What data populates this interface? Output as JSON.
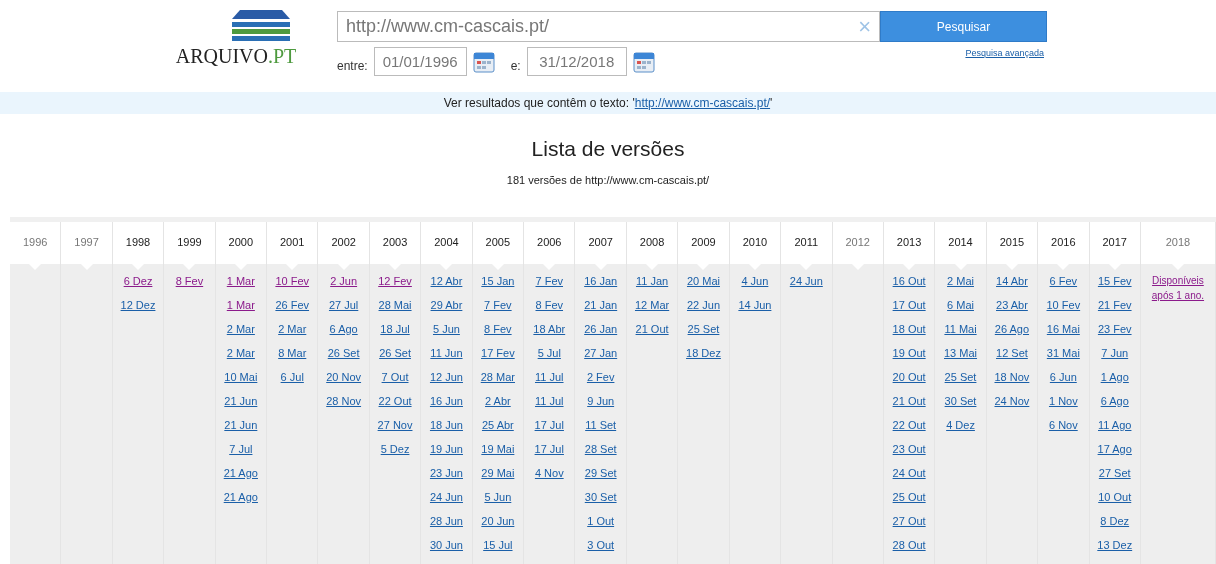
{
  "logo": {
    "text": "ARQUIVO",
    "suffix": ".PT"
  },
  "search": {
    "value": "http://www.cm-cascais.pt/",
    "clear": "×",
    "button": "Pesquisar",
    "advanced": "Pesquisa avançada"
  },
  "dates": {
    "from_label": "entre:",
    "from": "01/01/1996",
    "to_label": "e:",
    "to": "31/12/2018"
  },
  "banner": {
    "text": "Ver resultados que contêm o texto: '",
    "link": "http://www.cm-cascais.pt/",
    "after": "'"
  },
  "title": "Lista de versões",
  "subtitle": "181 versões de http://www.cm-cascais.pt/",
  "years": [
    {
      "year": "1996",
      "disabled": true
    },
    {
      "year": "1997",
      "disabled": true
    },
    {
      "year": "1998",
      "disabled": false,
      "versions": [
        {
          "label": "6 Dez",
          "visited": true
        },
        {
          "label": "12 Dez",
          "visited": false
        }
      ]
    },
    {
      "year": "1999",
      "disabled": false,
      "versions": [
        {
          "label": "8 Fev",
          "visited": true
        }
      ]
    },
    {
      "year": "2000",
      "disabled": false,
      "versions": [
        {
          "label": "1 Mar",
          "visited": true
        },
        {
          "label": "1 Mar",
          "visited": true
        },
        {
          "label": "2 Mar",
          "visited": false
        },
        {
          "label": "2 Mar",
          "visited": false
        },
        {
          "label": "10 Mai",
          "visited": false
        },
        {
          "label": "21 Jun",
          "visited": false
        },
        {
          "label": "21 Jun",
          "visited": false
        },
        {
          "label": "7 Jul",
          "visited": false
        },
        {
          "label": "21 Ago",
          "visited": false
        },
        {
          "label": "21 Ago",
          "visited": false
        }
      ]
    },
    {
      "year": "2001",
      "disabled": false,
      "versions": [
        {
          "label": "10 Fev",
          "visited": true
        },
        {
          "label": "26 Fev",
          "visited": false
        },
        {
          "label": "2 Mar",
          "visited": false
        },
        {
          "label": "8 Mar",
          "visited": false
        },
        {
          "label": "6 Jul",
          "visited": false
        }
      ]
    },
    {
      "year": "2002",
      "disabled": false,
      "versions": [
        {
          "label": "2 Jun",
          "visited": true
        },
        {
          "label": "27 Jul",
          "visited": false
        },
        {
          "label": "6 Ago",
          "visited": false
        },
        {
          "label": "26 Set",
          "visited": false
        },
        {
          "label": "20 Nov",
          "visited": false
        },
        {
          "label": "28 Nov",
          "visited": false
        }
      ]
    },
    {
      "year": "2003",
      "disabled": false,
      "versions": [
        {
          "label": "12 Fev",
          "visited": true
        },
        {
          "label": "28 Mai",
          "visited": false
        },
        {
          "label": "18 Jul",
          "visited": false
        },
        {
          "label": "26 Set",
          "visited": false
        },
        {
          "label": "7 Out",
          "visited": false
        },
        {
          "label": "22 Out",
          "visited": false
        },
        {
          "label": "27 Nov",
          "visited": false
        },
        {
          "label": "5 Dez",
          "visited": false
        }
      ]
    },
    {
      "year": "2004",
      "disabled": false,
      "versions": [
        {
          "label": "12 Abr",
          "visited": false
        },
        {
          "label": "29 Abr",
          "visited": false
        },
        {
          "label": "5 Jun",
          "visited": false
        },
        {
          "label": "11 Jun",
          "visited": false
        },
        {
          "label": "12 Jun",
          "visited": false
        },
        {
          "label": "16 Jun",
          "visited": false
        },
        {
          "label": "18 Jun",
          "visited": false
        },
        {
          "label": "19 Jun",
          "visited": false
        },
        {
          "label": "23 Jun",
          "visited": false
        },
        {
          "label": "24 Jun",
          "visited": false
        },
        {
          "label": "28 Jun",
          "visited": false
        },
        {
          "label": "30 Jun",
          "visited": false
        }
      ]
    },
    {
      "year": "2005",
      "disabled": false,
      "versions": [
        {
          "label": "15 Jan",
          "visited": false
        },
        {
          "label": "7 Fev",
          "visited": false
        },
        {
          "label": "8 Fev",
          "visited": false
        },
        {
          "label": "17 Fev",
          "visited": false
        },
        {
          "label": "28 Mar",
          "visited": false
        },
        {
          "label": "2 Abr",
          "visited": false
        },
        {
          "label": "25 Abr",
          "visited": false
        },
        {
          "label": "19 Mai",
          "visited": false
        },
        {
          "label": "29 Mai",
          "visited": false
        },
        {
          "label": "5 Jun",
          "visited": false
        },
        {
          "label": "20 Jun",
          "visited": false
        },
        {
          "label": "15 Jul",
          "visited": false
        }
      ]
    },
    {
      "year": "2006",
      "disabled": false,
      "versions": [
        {
          "label": "7 Fev",
          "visited": false
        },
        {
          "label": "8 Fev",
          "visited": false
        },
        {
          "label": "18 Abr",
          "visited": false
        },
        {
          "label": "5 Jul",
          "visited": false
        },
        {
          "label": "11 Jul",
          "visited": false
        },
        {
          "label": "11 Jul",
          "visited": false
        },
        {
          "label": "17 Jul",
          "visited": false
        },
        {
          "label": "17 Jul",
          "visited": false
        },
        {
          "label": "4 Nov",
          "visited": false
        }
      ]
    },
    {
      "year": "2007",
      "disabled": false,
      "versions": [
        {
          "label": "16 Jan",
          "visited": false
        },
        {
          "label": "21 Jan",
          "visited": false
        },
        {
          "label": "26 Jan",
          "visited": false
        },
        {
          "label": "27 Jan",
          "visited": false
        },
        {
          "label": "2 Fev",
          "visited": false
        },
        {
          "label": "9 Jun",
          "visited": false
        },
        {
          "label": "11 Set",
          "visited": false
        },
        {
          "label": "28 Set",
          "visited": false
        },
        {
          "label": "29 Set",
          "visited": false
        },
        {
          "label": "30 Set",
          "visited": false
        },
        {
          "label": "1 Out",
          "visited": false
        },
        {
          "label": "3 Out",
          "visited": false
        }
      ]
    },
    {
      "year": "2008",
      "disabled": false,
      "versions": [
        {
          "label": "11 Jan",
          "visited": false
        },
        {
          "label": "12 Mar",
          "visited": false
        },
        {
          "label": "21 Out",
          "visited": false
        }
      ]
    },
    {
      "year": "2009",
      "disabled": false,
      "versions": [
        {
          "label": "20 Mai",
          "visited": false
        },
        {
          "label": "22 Jun",
          "visited": false
        },
        {
          "label": "25 Set",
          "visited": false
        },
        {
          "label": "18 Dez",
          "visited": false
        }
      ]
    },
    {
      "year": "2010",
      "disabled": false,
      "versions": [
        {
          "label": "4 Jun",
          "visited": false
        },
        {
          "label": "14 Jun",
          "visited": false
        }
      ]
    },
    {
      "year": "2011",
      "disabled": false,
      "versions": [
        {
          "label": "24 Jun",
          "visited": false
        }
      ]
    },
    {
      "year": "2012",
      "disabled": true
    },
    {
      "year": "2013",
      "disabled": false,
      "versions": [
        {
          "label": "16 Out",
          "visited": false
        },
        {
          "label": "17 Out",
          "visited": false
        },
        {
          "label": "18 Out",
          "visited": false
        },
        {
          "label": "19 Out",
          "visited": false
        },
        {
          "label": "20 Out",
          "visited": false
        },
        {
          "label": "21 Out",
          "visited": false
        },
        {
          "label": "22 Out",
          "visited": false
        },
        {
          "label": "23 Out",
          "visited": false
        },
        {
          "label": "24 Out",
          "visited": false
        },
        {
          "label": "25 Out",
          "visited": false
        },
        {
          "label": "27 Out",
          "visited": false
        },
        {
          "label": "28 Out",
          "visited": false
        }
      ]
    },
    {
      "year": "2014",
      "disabled": false,
      "versions": [
        {
          "label": "2 Mai",
          "visited": false
        },
        {
          "label": "6 Mai",
          "visited": false
        },
        {
          "label": "11 Mai",
          "visited": false
        },
        {
          "label": "13 Mai",
          "visited": false
        },
        {
          "label": "25 Set",
          "visited": false
        },
        {
          "label": "30 Set",
          "visited": false
        },
        {
          "label": "4 Dez",
          "visited": false
        }
      ]
    },
    {
      "year": "2015",
      "disabled": false,
      "versions": [
        {
          "label": "14 Abr",
          "visited": false
        },
        {
          "label": "23 Abr",
          "visited": false
        },
        {
          "label": "26 Ago",
          "visited": false
        },
        {
          "label": "12 Set",
          "visited": false
        },
        {
          "label": "18 Nov",
          "visited": false
        },
        {
          "label": "24 Nov",
          "visited": false
        }
      ]
    },
    {
      "year": "2016",
      "disabled": false,
      "versions": [
        {
          "label": "6 Fev",
          "visited": false
        },
        {
          "label": "10 Fev",
          "visited": false
        },
        {
          "label": "16 Mai",
          "visited": false
        },
        {
          "label": "31 Mai",
          "visited": false
        },
        {
          "label": "6 Jun",
          "visited": false
        },
        {
          "label": "1 Nov",
          "visited": false
        },
        {
          "label": "6 Nov",
          "visited": false
        }
      ]
    },
    {
      "year": "2017",
      "disabled": false,
      "versions": [
        {
          "label": "15 Fev",
          "visited": false
        },
        {
          "label": "21 Fev",
          "visited": false
        },
        {
          "label": "23 Fev",
          "visited": false
        },
        {
          "label": "7 Jun",
          "visited": false
        },
        {
          "label": "1 Ago",
          "visited": false
        },
        {
          "label": "6 Ago",
          "visited": false
        },
        {
          "label": "11 Ago",
          "visited": false
        },
        {
          "label": "17 Ago",
          "visited": false
        },
        {
          "label": "27 Set",
          "visited": false
        },
        {
          "label": "10 Out",
          "visited": false
        },
        {
          "label": "8 Dez",
          "visited": false
        },
        {
          "label": "13 Dez",
          "visited": false
        }
      ]
    },
    {
      "year": "2018",
      "disabled": true,
      "note": "Disponíveis após 1 ano."
    }
  ]
}
